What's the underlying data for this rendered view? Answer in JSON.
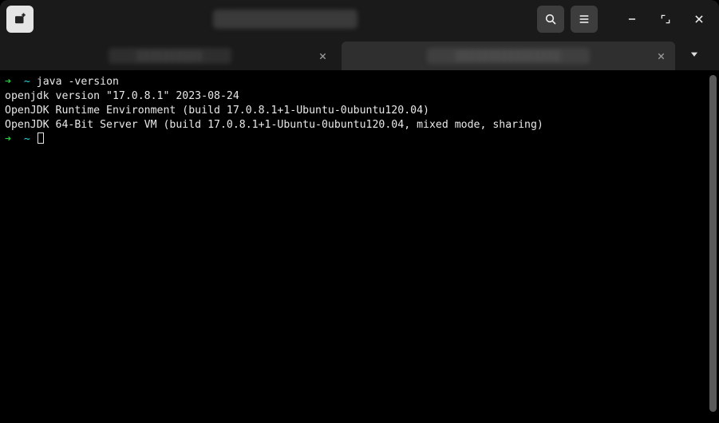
{
  "titlebar": {
    "title_obscured": "██████████████"
  },
  "tabs": [
    {
      "label_obscured": "██████████",
      "active": false
    },
    {
      "label_obscured": "████████████████",
      "active": true
    }
  ],
  "terminal": {
    "prompt_arrow": "➜",
    "prompt_dir": "~",
    "command": "java -version",
    "output": [
      "openjdk version \"17.0.8.1\" 2023-08-24",
      "OpenJDK Runtime Environment (build 17.0.8.1+1-Ubuntu-0ubuntu120.04)",
      "OpenJDK 64-Bit Server VM (build 17.0.8.1+1-Ubuntu-0ubuntu120.04, mixed mode, sharing)"
    ]
  }
}
